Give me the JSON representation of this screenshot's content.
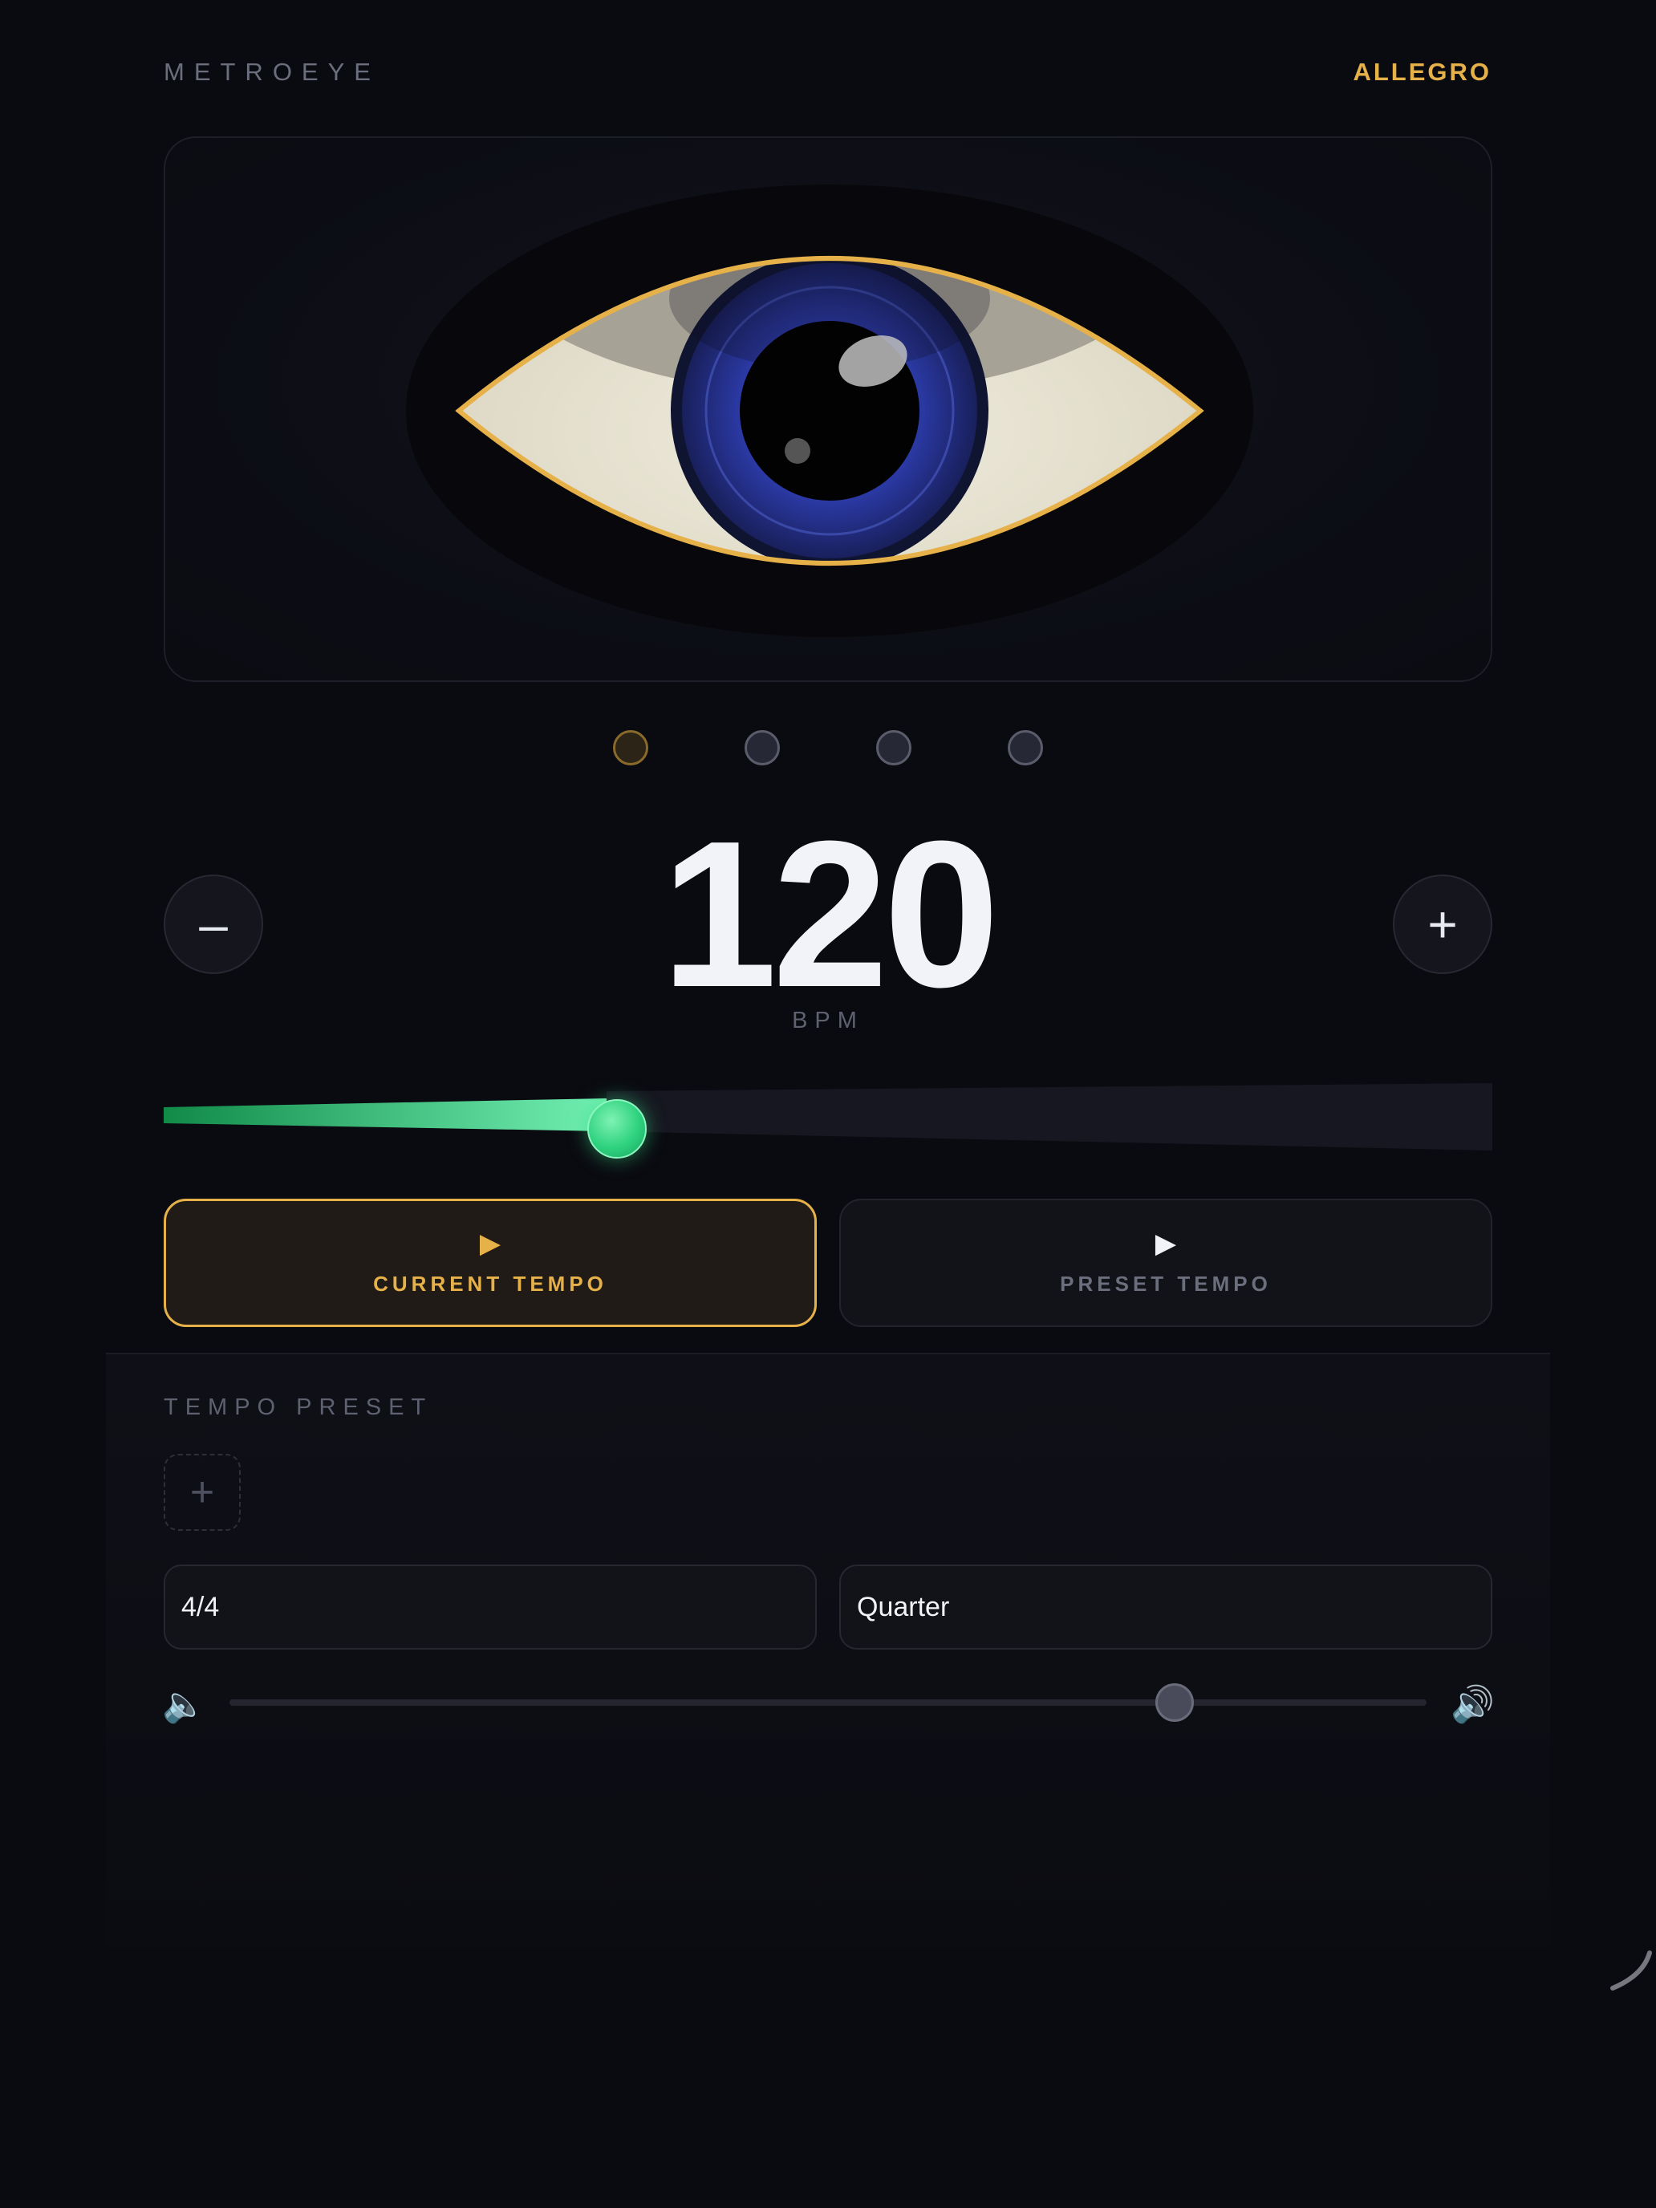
{
  "header": {
    "brand": "METROEYE",
    "tempo_marking": "ALLEGRO"
  },
  "beats": {
    "count": 4,
    "active_index": 0
  },
  "tempo": {
    "value": "120",
    "unit": "BPM",
    "decrement_label": "–",
    "increment_label": "+",
    "slider_fraction": 0.35
  },
  "playback": {
    "current_icon": "play-icon",
    "current_label": "CURRENT TEMPO",
    "preset_icon": "play-icon",
    "preset_label": "PRESET TEMPO"
  },
  "presets": {
    "title": "TEMPO PRESET",
    "add_label": "+",
    "time_signature": "4/4",
    "note_value": "Quarter"
  },
  "volume": {
    "low_icon": "🔈",
    "high_icon": "🔊",
    "level_fraction": 0.79
  },
  "colors": {
    "accent": "#e7b14a",
    "tempo_green": "#2ed27f",
    "iris": "#2b3aa6",
    "background": "#0a0b11"
  }
}
